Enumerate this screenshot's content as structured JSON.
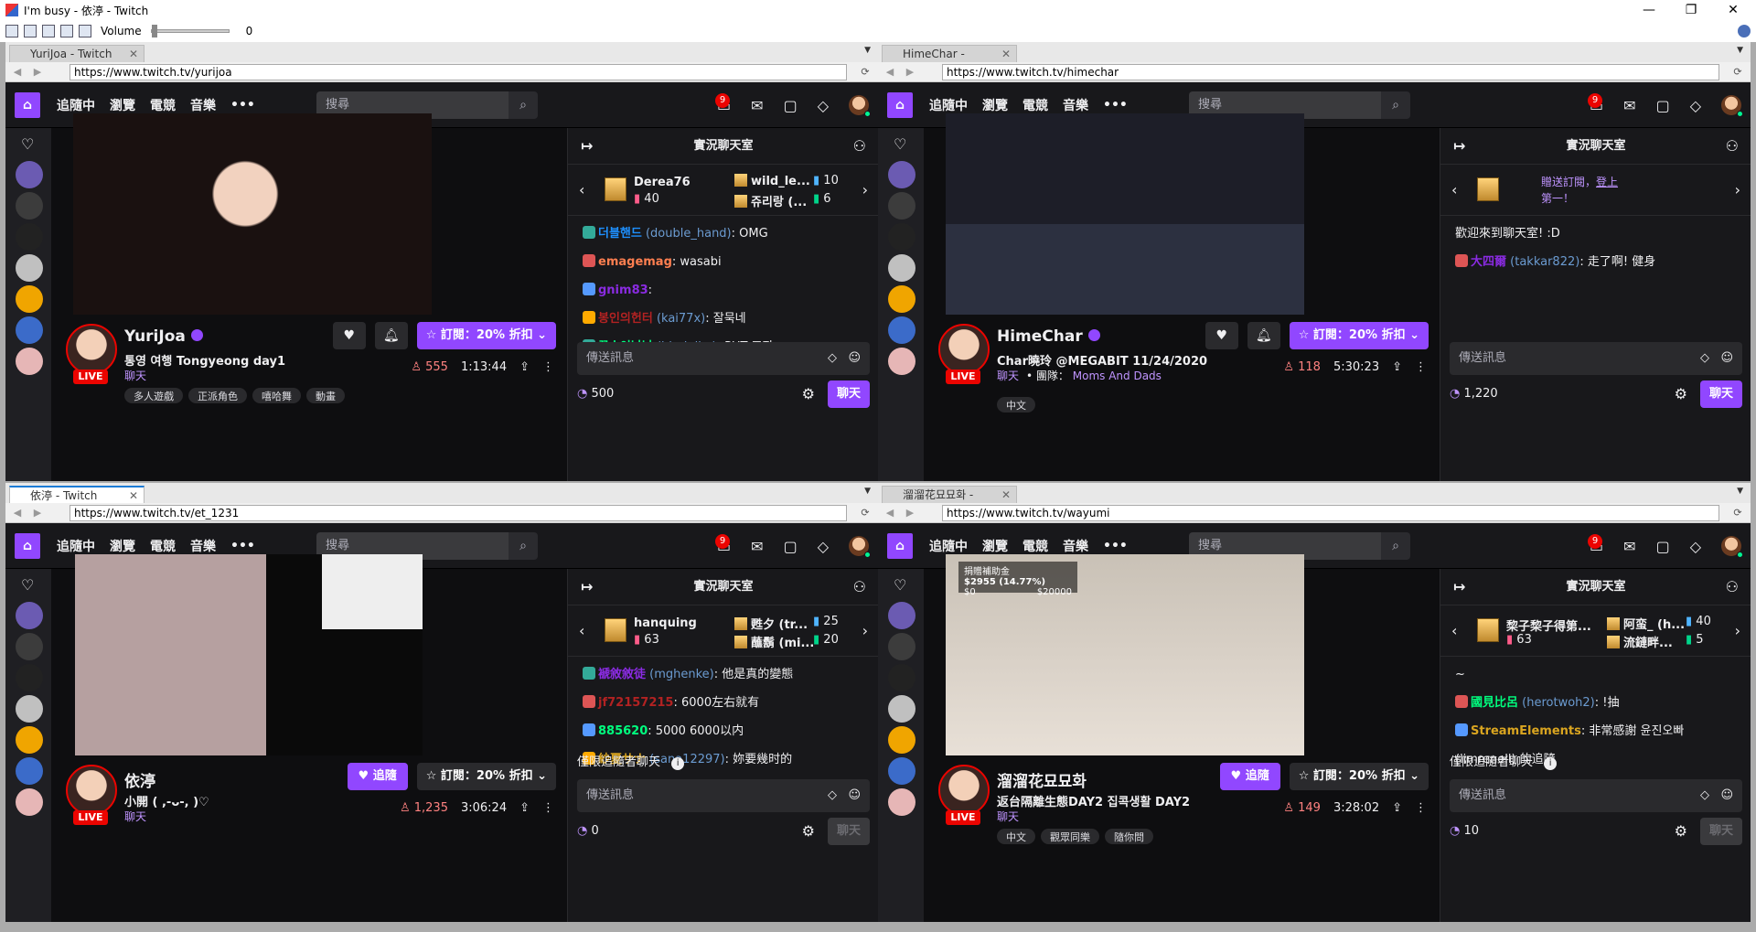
{
  "window": {
    "title": "I'm busy - 依渟 - Twitch"
  },
  "toolbar": {
    "volume_label": "Volume",
    "volume_value": "0"
  },
  "panes": [
    {
      "tab_title": "YuriJoa - Twitch",
      "url": "https://www.twitch.tv/yurijoa",
      "nav": {
        "following": "追隨中",
        "browse": "瀏覽",
        "esports": "電競",
        "music": "音樂",
        "more": "•••",
        "search_placeholder": "搜尋",
        "notif_count": "9"
      },
      "chat_header": "實況聊天室",
      "gifts": {
        "left_name": "Derea76",
        "left_count": "40",
        "top_right": "wild_le...",
        "top_right_count": "10",
        "bot_right": "쥬리랑 (...",
        "bot_right_count": "6"
      },
      "messages": [
        {
          "user": "더블핸드",
          "login": "(double_hand)",
          "text": "OMG"
        },
        {
          "user": "emagemag",
          "text": "wasabi"
        },
        {
          "user": "gnim83",
          "text": ""
        },
        {
          "user": "봉인의헌터",
          "login": "(kai77x)",
          "text": "잘묵네"
        },
        {
          "user": "꿀순이남남",
          "login": "(bludpika)",
          "text": "PUT 조장"
        }
      ],
      "input_placeholder": "傳送訊息",
      "points": "500",
      "chat_button": "聊天",
      "streamer": {
        "name": "YuriJoa",
        "title": "통영 여행 Tongyeong day1",
        "category": "聊天",
        "viewers": "555",
        "uptime": "1:13:44",
        "live": "LIVE",
        "sub_label": "訂閱：20% 折扣",
        "tags": [
          "多人遊戲",
          "正派角色",
          "嘻哈舞",
          "動畫"
        ]
      }
    },
    {
      "tab_title": "HimeChar - Twitch",
      "url": "https://www.twitch.tv/himechar",
      "nav": {
        "following": "追隨中",
        "browse": "瀏覽",
        "esports": "電競",
        "music": "音樂",
        "more": "•••",
        "search_placeholder": "搜尋",
        "notif_count": "9"
      },
      "chat_header": "實況聊天室",
      "gift_text_1": "贈送訂閱，",
      "gift_text_link": "登上",
      "gift_text_2": "第一！",
      "messages": [
        {
          "user": "",
          "text": "歡迎來到聊天室! :D"
        },
        {
          "user": "大四爾",
          "login": "(takkar822)",
          "text": "走了啊! 健身"
        }
      ],
      "input_placeholder": "傳送訊息",
      "points": "1,220",
      "chat_button": "聊天",
      "streamer": {
        "name": "HimeChar",
        "title": "Char曉玲 @MEGABIT 11/24/2020",
        "category": "聊天",
        "team_label": "團隊：",
        "team": "Moms And Dads",
        "viewers": "118",
        "uptime": "5:30:23",
        "live": "LIVE",
        "sub_label": "訂閱：20% 折扣",
        "tags": [
          "中文"
        ]
      }
    },
    {
      "tab_title": "依渟 - Twitch",
      "url": "https://www.twitch.tv/et_1231",
      "nav": {
        "following": "追隨中",
        "browse": "瀏覽",
        "esports": "電競",
        "music": "音樂",
        "more": "•••",
        "search_placeholder": "搜尋",
        "notif_count": "9"
      },
      "chat_header": "實況聊天室",
      "gifts": {
        "left_name": "hanquing",
        "left_count": "63",
        "top_right": "甦夕 (tr...",
        "top_right_count": "25",
        "bot_right": "蘸鬍 (mi...",
        "bot_right_count": "20"
      },
      "messages": [
        {
          "user": "褫敘敘徒",
          "login": "(mghenke)",
          "text": "他是真的變態"
        },
        {
          "user": "jf72157215",
          "text": "6000左右就有"
        },
        {
          "user": "885620",
          "text": "5000 6000以内"
        },
        {
          "user": "紗夏サナ",
          "login": "(sana12297)",
          "text": "妳要幾时的"
        }
      ],
      "followers_only": "僅限追隨者聊天",
      "input_placeholder": "傳送訊息",
      "points": "0",
      "chat_button": "聊天",
      "streamer": {
        "name": "依渟",
        "title": "小開 ( ,-ᴗ-, )♡",
        "category": "聊天",
        "viewers": "1,235",
        "uptime": "3:06:24",
        "live": "LIVE",
        "follow_label": "追隨",
        "sub_label": "訂閱：20% 折扣",
        "tags": []
      }
    },
    {
      "tab_title": "溜溜花묘묘화 - Twitch",
      "url": "https://www.twitch.tv/wayumi",
      "nav": {
        "following": "追隨中",
        "browse": "瀏覽",
        "esports": "電競",
        "music": "音樂",
        "more": "•••",
        "search_placeholder": "搜尋",
        "notif_count": "9"
      },
      "chat_header": "實況聊天室",
      "gifts": {
        "left_name": "棃子棃子得第...",
        "left_count": "63",
        "top_right": "阿蛮_ (h...",
        "top_right_count": "40",
        "bot_right": "流鏈畔...",
        "bot_right_count": "5"
      },
      "messages": [
        {
          "user": "",
          "text": "~"
        },
        {
          "user": "國見比呂",
          "login": "(herotwoh2)",
          "text": "!抽"
        },
        {
          "user": "StreamElements",
          "text": "非常感謝 윤진오빠"
        },
        {
          "user": "",
          "text": "(limrenell) 的追隨"
        }
      ],
      "followers_only": "僅限追隨者聊天",
      "input_placeholder": "傳送訊息",
      "points": "10",
      "chat_button": "聊天",
      "overlay": {
        "title": "捐贈補助金",
        "amount": "$2955 (14.77%)",
        "min": "$0",
        "max": "$20000"
      },
      "streamer": {
        "name": "溜溜花묘묘화",
        "title": "返台隔離生態DAY2 집콕생활 DAY2",
        "category": "聊天",
        "viewers": "149",
        "uptime": "3:28:02",
        "live": "LIVE",
        "follow_label": "追隨",
        "sub_label": "訂閱：20% 折扣",
        "tags": [
          "中文",
          "觀眾同樂",
          "隨你問"
        ]
      }
    }
  ],
  "colors": {
    "twitch_purple": "#9147ff",
    "live_red": "#eb0400",
    "bg": "#0e0e10"
  }
}
